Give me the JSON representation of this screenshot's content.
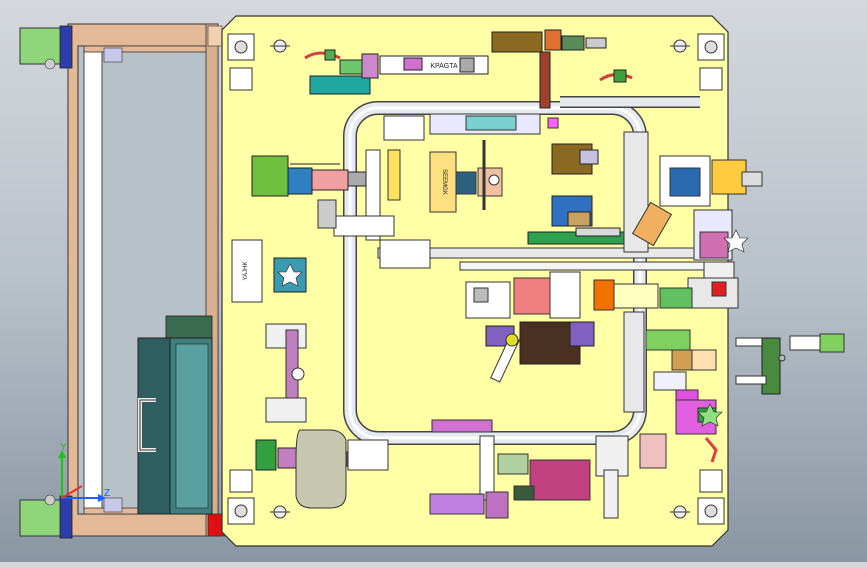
{
  "viewport": {
    "background_top": "#d4d8dc",
    "background_bottom": "#8a96a3"
  },
  "base_plate": {
    "color": "#ffffa6"
  },
  "frame": {
    "color": "#e3b998"
  },
  "tube": {
    "color": "#dfe4e8"
  },
  "part_labels": {
    "clamp_tag_top": "KPAGTA",
    "side_label": "SEEMGK",
    "nameplate": "YAJHK"
  },
  "axis_triad": {
    "y_label": "Y",
    "z_label": "Z",
    "x_color": "#2060ff",
    "y_color": "#20c020",
    "z_color": "#2060ff"
  },
  "icons": [
    "axis-triad-icon",
    "locating-pin-icon",
    "clamp-icon",
    "handle-icon"
  ]
}
